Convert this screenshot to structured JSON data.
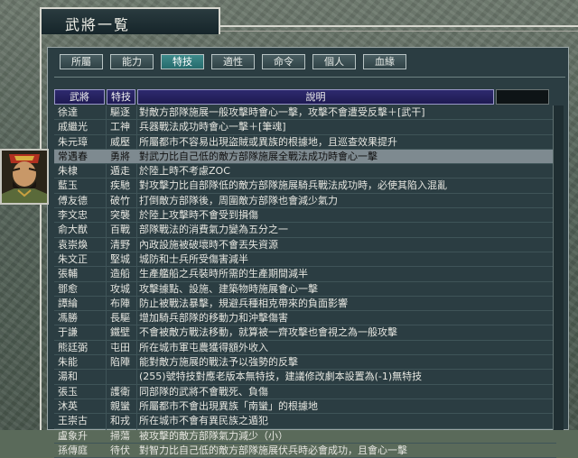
{
  "window": {
    "title": "武將一覧"
  },
  "tabs": [
    {
      "label": "所屬",
      "active": false
    },
    {
      "label": "能力",
      "active": false
    },
    {
      "label": "特技",
      "active": true
    },
    {
      "label": "適性",
      "active": false
    },
    {
      "label": "命令",
      "active": false
    },
    {
      "label": "個人",
      "active": false
    },
    {
      "label": "血緣",
      "active": false
    }
  ],
  "table": {
    "headers": {
      "name": "武將",
      "skill": "特技",
      "desc": "說明"
    },
    "selected_index": 3,
    "rows": [
      {
        "name": "徐達",
        "skill": "驅逐",
        "desc": "對敵方部隊施展一般攻擊時會心一擊，攻擊不會遭受反擊＋[武干]"
      },
      {
        "name": "戚繼光",
        "skill": "工神",
        "desc": "兵器戰法成功時會心一擊＋[筆魂]"
      },
      {
        "name": "朱元璋",
        "skill": "威壓",
        "desc": "所屬都市不容易出現盜賊或異族的根據地，且巡查效果提升"
      },
      {
        "name": "常遇春",
        "skill": "勇將",
        "desc": "對武力比自己低的敵方部隊施展全戰法成功時會心一擊"
      },
      {
        "name": "朱棣",
        "skill": "遁走",
        "desc": "於陸上時不考慮ZOC"
      },
      {
        "name": "藍玉",
        "skill": "疾馳",
        "desc": "對攻擊力比自部隊低的敵方部隊施展騎兵戰法成功時，必使其陷入混亂"
      },
      {
        "name": "傅友德",
        "skill": "破竹",
        "desc": "打倒敵方部隊後，周圍敵方部隊也會減少氣力"
      },
      {
        "name": "李文忠",
        "skill": "突襲",
        "desc": "於陸上攻擊時不會受到損傷"
      },
      {
        "name": "俞大猷",
        "skill": "百戰",
        "desc": "部隊戰法的消費氣力變為五分之一"
      },
      {
        "name": "袁崇煥",
        "skill": "清野",
        "desc": "內政設施被破壞時不會丟失資源"
      },
      {
        "name": "朱文正",
        "skill": "堅城",
        "desc": "城防和士兵所受傷害減半"
      },
      {
        "name": "張輔",
        "skill": "造船",
        "desc": "生產艦船之兵裝時所需的生產期間減半"
      },
      {
        "name": "鄧愈",
        "skill": "攻城",
        "desc": "攻擊據點、設施、建築物時施展會心一擊"
      },
      {
        "name": "譚綸",
        "skill": "布陣",
        "desc": "防止被戰法暴擊，規避兵種相克帶來的負面影響"
      },
      {
        "name": "馮勝",
        "skill": "長驅",
        "desc": "增加騎兵部隊的移動力和沖擊傷害"
      },
      {
        "name": "于謙",
        "skill": "鐵壁",
        "desc": "不會被敵方戰法移動，就算被一齊攻擊也會視之為一般攻擊"
      },
      {
        "name": "熊廷弼",
        "skill": "屯田",
        "desc": "所在城市軍屯農獲得額外收入"
      },
      {
        "name": "朱能",
        "skill": "陷陣",
        "desc": "能對敵方施展的戰法予以強勢的反擊"
      },
      {
        "name": "湯和",
        "skill": "",
        "desc": "(255)號特技對應老版本無特技，建議修改劇本設置為(-1)無特技"
      },
      {
        "name": "張玉",
        "skill": "護衛",
        "desc": "同部隊的武將不會戰死、負傷"
      },
      {
        "name": "沐英",
        "skill": "親蠻",
        "desc": "所屬都市不會出現異族「南蠻」的根據地"
      },
      {
        "name": "王崇古",
        "skill": "和戎",
        "desc": "所在城市不會有異民族之遁犯"
      },
      {
        "name": "盧象升",
        "skill": "掃蕩",
        "desc": "被攻擊的敵方部隊氣力減少（小）"
      },
      {
        "name": "孫傳庭",
        "skill": "待伏",
        "desc": "對智力比自己低的敵方部隊施展伏兵時必會成功，且會心一擊"
      }
    ]
  }
}
